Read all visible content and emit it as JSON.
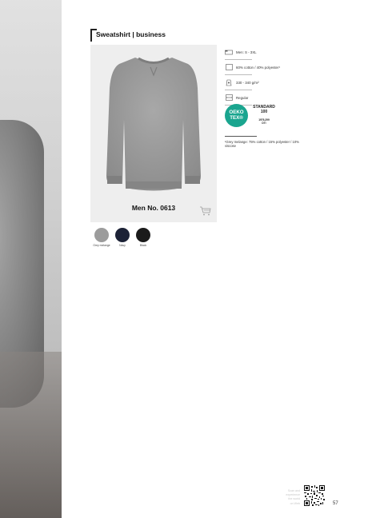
{
  "page": {
    "title": "Sweatshirt | business",
    "page_number": "57"
  },
  "product": {
    "name": "Men No. 0613",
    "image_alt": "grey sweatshirt"
  },
  "specs": [
    {
      "icon": "sizes-icon",
      "text": "Men: S - 3XL"
    },
    {
      "icon": "fabric-icon",
      "text": "60% cotton / 40% polyester¹"
    },
    {
      "icon": "weight-icon",
      "text": "330 - 340 g/m²"
    },
    {
      "icon": "fit-icon",
      "text": "Regular"
    }
  ],
  "certification": {
    "badge_line1": "OEKO",
    "badge_line2": "TEX®",
    "standard_line1": "STANDARD",
    "standard_line2": "100",
    "code_line1": "1976-299",
    "code_line2": "DTI"
  },
  "footnote": "¹Grey melange: 75% cotton / 15% polyester / 10% viscose",
  "colors": [
    {
      "label": "Grey melange",
      "hex": "#9c9c9c"
    },
    {
      "label": "Navy",
      "hex": "#1c2236"
    },
    {
      "label": "Black",
      "hex": "#1b1b1b"
    }
  ],
  "corner_text": [
    "Scan and",
    "experience",
    "the world",
    "on Web"
  ]
}
